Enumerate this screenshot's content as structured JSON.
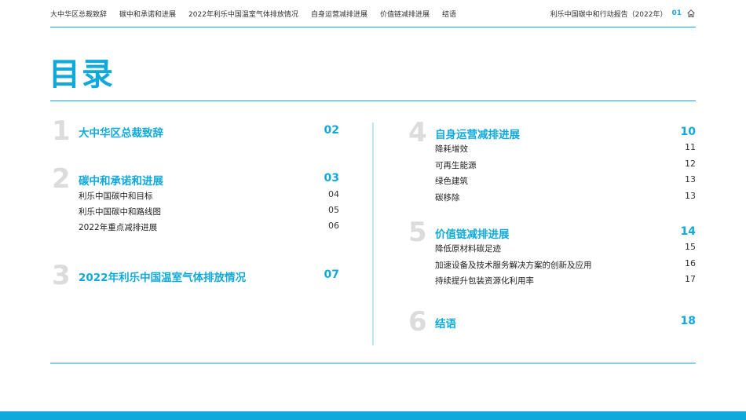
{
  "header": {
    "nav": [
      "大中华区总裁致辞",
      "碳中和承诺和进展",
      "2022年利乐中国温室气体排放情况",
      "自身运营减排进展",
      "价值链减排进展",
      "结语"
    ],
    "report_title": "利乐中国碳中和行动报告（2022年）",
    "page_number": "01",
    "home_icon": "home-icon"
  },
  "title": "目录",
  "colors": {
    "accent": "#10a9dc",
    "number_gray": "#dcdcdc"
  },
  "toc_left": [
    {
      "num": "1",
      "title": "大中华区总裁致辞",
      "page": "02",
      "items": []
    },
    {
      "num": "2",
      "title": "碳中和承诺和进展",
      "page": "03",
      "items": [
        {
          "label": "利乐中国碳中和目标",
          "page": "04"
        },
        {
          "label": "利乐中国碳中和路线图",
          "page": "05"
        },
        {
          "label": "2022年重点减排进展",
          "page": "06"
        }
      ]
    },
    {
      "num": "3",
      "title": "2022年利乐中国温室气体排放情况",
      "page": "07",
      "items": []
    }
  ],
  "toc_right": [
    {
      "num": "4",
      "title": "自身运营减排进展",
      "page": "10",
      "items": [
        {
          "label": "降耗增效",
          "page": "11"
        },
        {
          "label": "可再生能源",
          "page": "12"
        },
        {
          "label": "绿色建筑",
          "page": "13"
        },
        {
          "label": "碳移除",
          "page": "13"
        }
      ]
    },
    {
      "num": "5",
      "title": "价值链减排进展",
      "page": "14",
      "items": [
        {
          "label": "降低原材料碳足迹",
          "page": "15"
        },
        {
          "label": "加速设备及技术服务解决方案的创新及应用",
          "page": "16"
        },
        {
          "label": "持续提升包装资源化利用率",
          "page": "17"
        }
      ]
    },
    {
      "num": "6",
      "title": "结语",
      "page": "18",
      "items": []
    }
  ]
}
